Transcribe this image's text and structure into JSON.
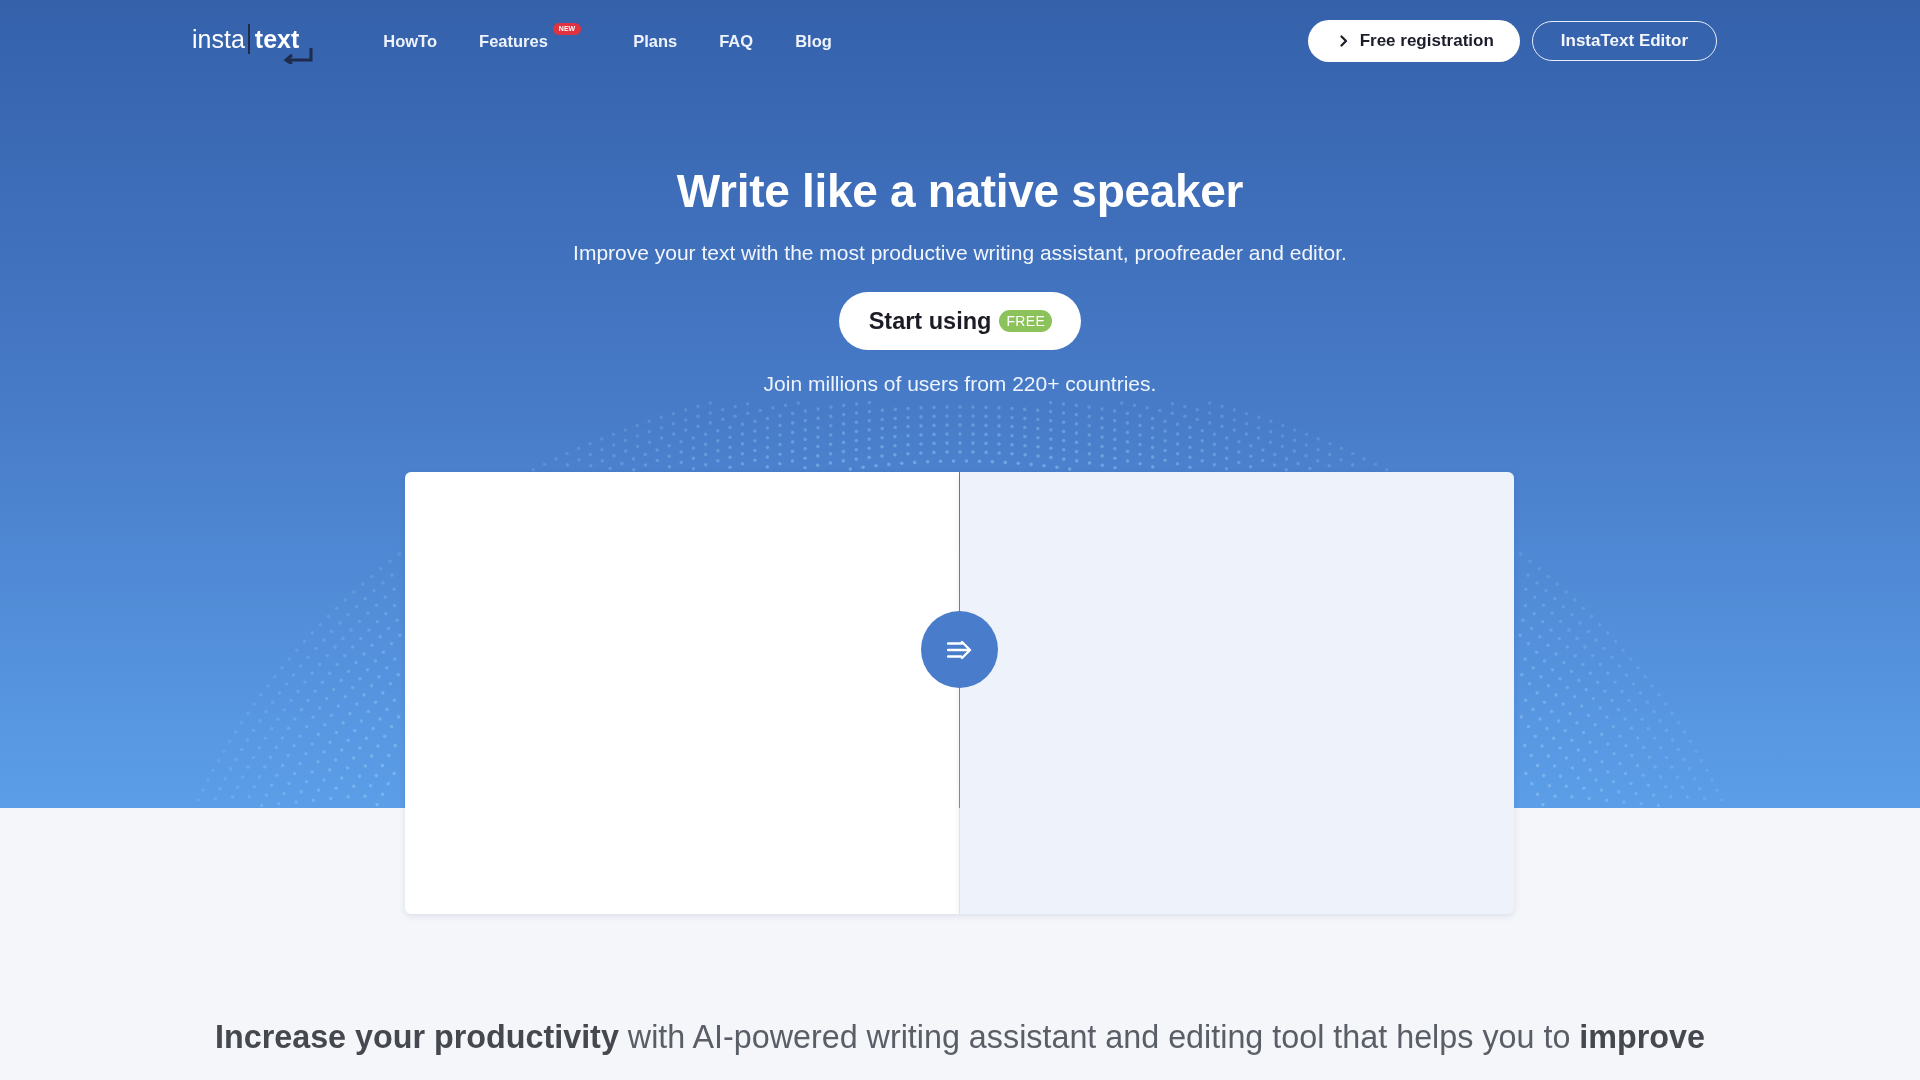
{
  "header": {
    "logo": {
      "part_1": "insta",
      "part_2": "text"
    },
    "nav": [
      {
        "label": "HowTo"
      },
      {
        "label": "Features",
        "badge": "NEW"
      },
      {
        "label": "Plans"
      },
      {
        "label": "FAQ"
      },
      {
        "label": "Blog"
      }
    ],
    "buttons": [
      {
        "label": "Free registration",
        "kind": "filled"
      },
      {
        "label": "InstaText Editor",
        "kind": "outline"
      }
    ]
  },
  "hero": {
    "title": "Write like a native speaker",
    "subtitle": "Improve your text with the most productive writing assistant, proofreader and editor.",
    "cta": {
      "label": "Start using",
      "badge": "FREE"
    },
    "note": "Join millions of users from 220+ countries."
  },
  "tagline": "**Increase your productivity** with AI-powered writing assistant and editing tool that helps you to **improve**"
}
